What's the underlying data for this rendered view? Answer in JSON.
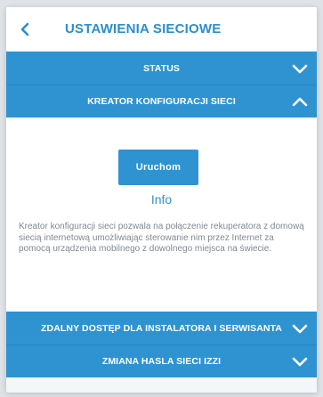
{
  "header": {
    "title": "USTAWIENIA SIECIOWE",
    "back_icon": "chevron-left-icon"
  },
  "sections": {
    "status": {
      "label": "STATUS",
      "state": "collapsed"
    },
    "kreator": {
      "label": "KREATOR KONFIGURACJI SIECI",
      "state": "expanded",
      "button_label": "Uruchom",
      "info_link": "Info",
      "description": "Kreator konfiguracji sieci pozwala na połączenie rekuperatora z domową siecią internetową umożliwiając sterowanie nim przez Internet za pomocą urządzenia mobilnego z dowolnego miejsca na świecie."
    },
    "zdalny": {
      "label": "ZDALNY DOSTĘP DLA INSTALATORA I SERWISANTA",
      "state": "collapsed"
    },
    "haslo": {
      "label": "ZMIANA HASLA SIECI IZZI",
      "state": "collapsed"
    }
  },
  "colors": {
    "accent": "#2f93d1",
    "title": "#2a8fcf",
    "text_muted": "#7f8a93"
  }
}
